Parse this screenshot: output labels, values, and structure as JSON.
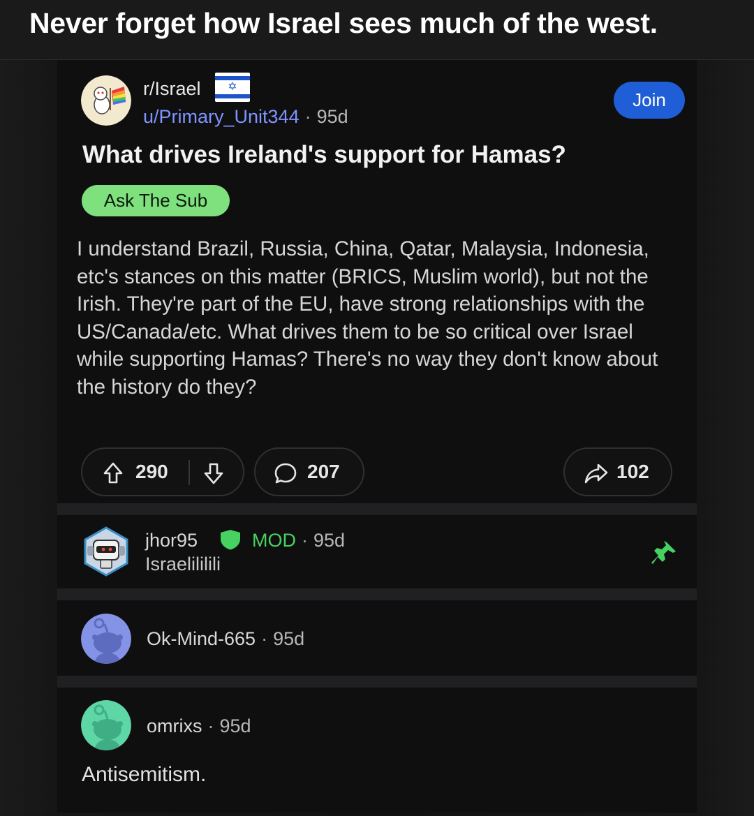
{
  "caption": "Never forget how Israel sees much of the west.",
  "post": {
    "subreddit": "r/Israel",
    "author": "u/Primary_Unit344",
    "separator": "·",
    "age": "95d",
    "join_label": "Join",
    "title": "What drives Ireland's support for Hamas?",
    "flair": "Ask The Sub",
    "body": "I understand Brazil, Russia, China, Qatar, Malaysia, Indonesia, etc's stances on this matter (BRICS, Muslim world), but not the Irish. They're part of the EU, have strong relationships with the US/Canada/etc. What drives them to be so critical over Israel while supporting Hamas? There's no way they don't know about the history do they?",
    "upvotes": "290",
    "comments": "207",
    "shares": "102"
  },
  "comments": [
    {
      "username": "jhor95",
      "badge": "MOD",
      "age": "95d",
      "flair": "Israelililili",
      "pinned": true
    },
    {
      "username": "Ok-Mind-665",
      "age": "95d"
    },
    {
      "username": "omrixs",
      "age": "95d",
      "body": "Antisemitism."
    }
  ],
  "colors": {
    "join_blue": "#1f5ed6",
    "flair_green": "#7fe07e",
    "mod_green": "#46d160",
    "username_link": "#7e94ff",
    "avatar_blue": "#8593e6",
    "avatar_teal": "#5fd6a6"
  },
  "icons": [
    "subreddit-avatar-icon",
    "israel-flag-icon",
    "upvote-icon",
    "downvote-icon",
    "comment-icon",
    "share-icon",
    "mod-shield-icon",
    "pin-icon",
    "snoo-avatar-icon"
  ]
}
